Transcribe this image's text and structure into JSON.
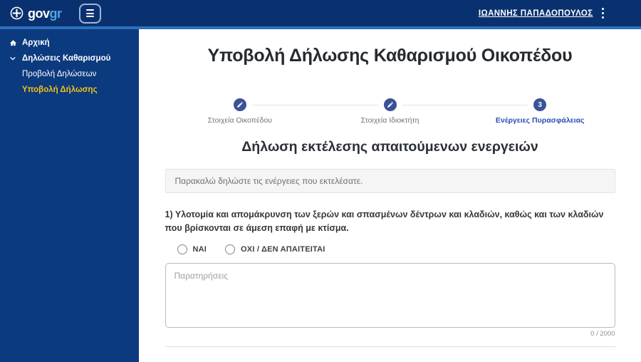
{
  "header": {
    "logo": {
      "gov": "gov",
      "gr": "gr"
    },
    "user": "ΙΩΑΝΝΗΣ ΠΑΠΑΔΟΠΟΥΛΟΣ"
  },
  "sidebar": {
    "items": [
      {
        "label": "Αρχική",
        "icon": "home-icon"
      },
      {
        "label": "Δηλώσεις Καθαρισμού",
        "icon": "chevron-down-icon"
      },
      {
        "label": "Προβολή Δηλώσεων"
      },
      {
        "label": "Υποβολή Δήλωσης",
        "active": true
      }
    ]
  },
  "main": {
    "title": "Υποβολή Δήλωσης Καθαρισμού Οικοπέδου",
    "stepper": {
      "steps": [
        {
          "label": "Στοιχεία Οικοπέδου",
          "state": "completed"
        },
        {
          "label": "Στοιχεία Ιδιοκτήτη",
          "state": "completed"
        },
        {
          "label": "Ενέργειες Πυρασφάλειας",
          "state": "active",
          "number": "3"
        }
      ]
    },
    "section_title": "Δήλωση εκτέλεσης απαιτούμενων ενεργειών",
    "info_message": "Παρακαλώ δηλώστε τις ενέργειες που εκτελέσατε.",
    "question": {
      "text": "1) Υλοτομία και απομάκρυνση των ξερών και σπασμένων δέντρων και κλαδιών, καθώς και των κλαδιών που βρίσκονται σε άμεση επαφή με κτίσμα.",
      "options": [
        {
          "label": "ΝΑΙ"
        },
        {
          "label": "ΟΧΙ / ΔΕΝ ΑΠΑΙΤΕΙΤΑΙ"
        }
      ],
      "textarea_placeholder": "Παρατηρήσεις",
      "textarea_value": "",
      "char_counter": "0 / 2000"
    }
  },
  "colors": {
    "header_bg": "#0a316f",
    "accent_bar": "#2c6fbe",
    "sidebar_bg": "#0c3a7e",
    "active_link": "#f2c118",
    "stepper_circle": "#3a5298",
    "active_step_label": "#2b4eb2",
    "logo_gr": "#4fa7e8"
  }
}
